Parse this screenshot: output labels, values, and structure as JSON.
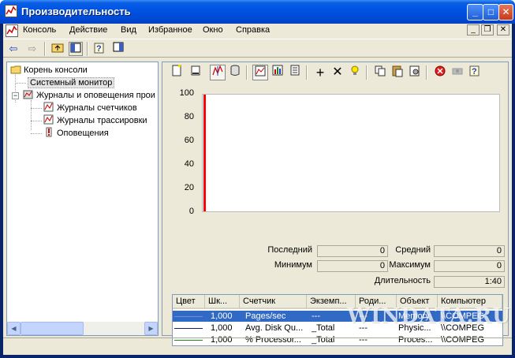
{
  "window": {
    "title": "Производительность"
  },
  "menu": {
    "items": [
      "Консоль",
      "Действие",
      "Вид",
      "Избранное",
      "Окно",
      "Справка"
    ]
  },
  "tree": {
    "root": "Корень консоли",
    "items": [
      {
        "label": "Системный монитор",
        "selected": true
      },
      {
        "label": "Журналы и оповещения прои"
      },
      {
        "label": "Журналы счетчиков"
      },
      {
        "label": "Журналы трассировки"
      },
      {
        "label": "Оповещения"
      }
    ]
  },
  "chart_data": {
    "type": "line",
    "yticks": [
      "100",
      "80",
      "60",
      "40",
      "20",
      "0"
    ],
    "ylim": [
      0,
      100
    ],
    "grid": false,
    "series_color": "#ff0000"
  },
  "stats": {
    "last_label": "Последний",
    "last_value": "0",
    "avg_label": "Средний",
    "avg_value": "0",
    "min_label": "Минимум",
    "min_value": "0",
    "max_label": "Максимум",
    "max_value": "0",
    "duration_label": "Длительность",
    "duration_value": "1:40"
  },
  "counters": {
    "columns": [
      "Цвет",
      "Шк...",
      "Счетчик",
      "Экземп...",
      "Роди...",
      "Объект",
      "Компьютер"
    ],
    "rows": [
      {
        "color": "#6a8fd8",
        "scale": "1,000",
        "counter": "Pages/sec",
        "instance": "---",
        "parent": "---",
        "object": "Memory",
        "computer": "\\\\COMPEG",
        "selected": true
      },
      {
        "color": "#1c1c6e",
        "scale": "1,000",
        "counter": "Avg. Disk Qu...",
        "instance": "_Total",
        "parent": "---",
        "object": "Physic...",
        "computer": "\\\\COMPEG"
      },
      {
        "color": "#1a8a1a",
        "scale": "1,000",
        "counter": "% Processor...",
        "instance": "_Total",
        "parent": "---",
        "object": "Proces...",
        "computer": "\\\\COMPEG"
      }
    ]
  },
  "watermark": "WINDATA.RU"
}
